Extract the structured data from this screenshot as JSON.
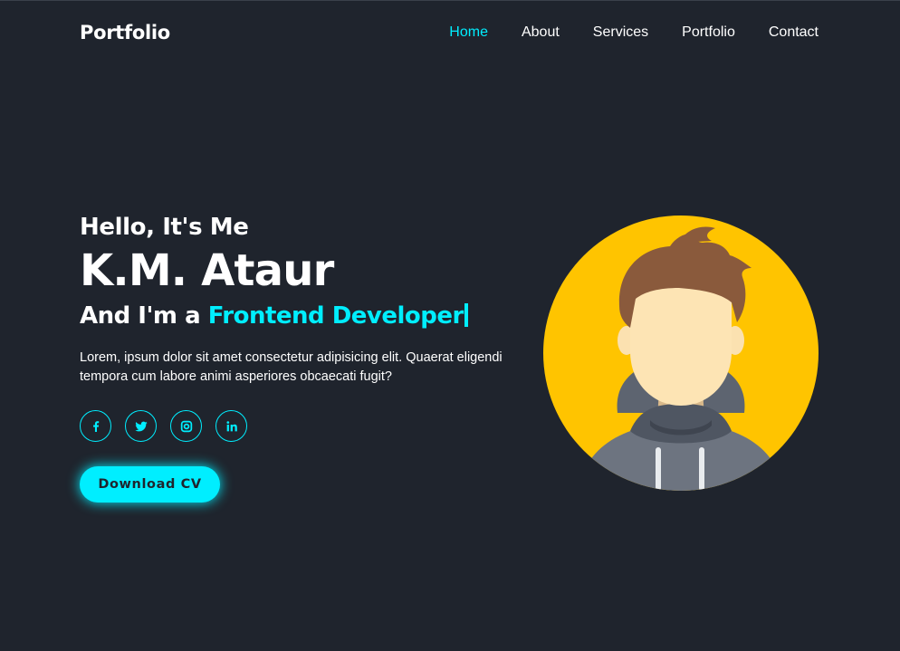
{
  "header": {
    "logo": "Portfolio",
    "nav": [
      "Home",
      "About",
      "Services",
      "Portfolio",
      "Contact"
    ],
    "active": "Home"
  },
  "home": {
    "greeting": "Hello, It's Me",
    "name": "K.M. Ataur",
    "role_prefix": "And I'm a",
    "role": "Frontend Developer",
    "description": "Lorem, ipsum dolor sit amet consectetur adipisicing elit. Quaerat eligendi tempora cum labore animi asperiores obcaecati fugit?",
    "social": [
      "facebook-icon",
      "twitter-icon",
      "instagram-icon",
      "linkedin-icon"
    ],
    "cv_button": "Download CV"
  },
  "colors": {
    "background": "#1f242d",
    "accent": "#00eeff",
    "text": "#ffffff",
    "avatar_bg": "#ffc400"
  }
}
